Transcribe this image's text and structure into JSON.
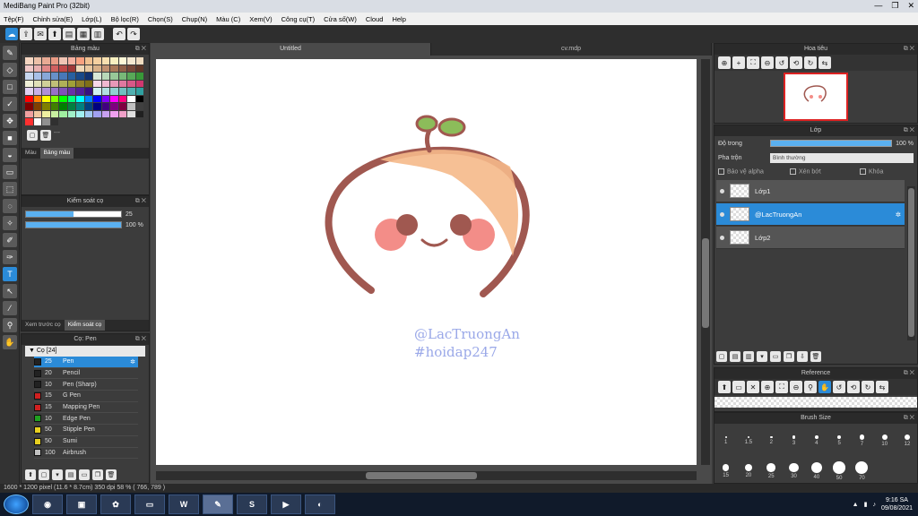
{
  "window": {
    "title": "MediBang Paint Pro (32bit)",
    "controls": [
      "—",
      "❐",
      "✕"
    ]
  },
  "menu": [
    "Tệp(F)",
    "Chỉnh sửa(E)",
    "Lớp(L)",
    "Bộ lọc(R)",
    "Chọn(S)",
    "Chụp(N)",
    "Màu (C)",
    "Xem(V)",
    "Công cụ(T)",
    "Cửa số(W)",
    "Cloud",
    "Help"
  ],
  "palette": {
    "title": "Bảng màu",
    "tabs": [
      "Màu",
      "Bảng màu"
    ],
    "colors": [
      "#f5d6c2",
      "#ecc0a8",
      "#e8aa94",
      "#e89a84",
      "#f0c4b4",
      "#f5b0a0",
      "#f7a080",
      "#f0c090",
      "#f5d0a0",
      "#f8e0b0",
      "#f8f0c0",
      "#fff8d8",
      "#f5e8d0",
      "#f0dcc0",
      "#f0c8c8",
      "#e8b0b0",
      "#e08888",
      "#d06060",
      "#c04848",
      "#a03838",
      "#f0d8b8",
      "#e8c8a0",
      "#d8b088",
      "#c09070",
      "#a87858",
      "#906048",
      "#784838",
      "#603828",
      "#c8d8f0",
      "#a8c0e8",
      "#88a8d8",
      "#6890c8",
      "#4878b8",
      "#2860a0",
      "#184888",
      "#103070",
      "#d8e8d8",
      "#b8d8b8",
      "#98c898",
      "#78b878",
      "#58a858",
      "#389838",
      "#f0f0d8",
      "#e0e0b8",
      "#d0d098",
      "#c0c078",
      "#b0b058",
      "#a0a038",
      "#908028",
      "#807018",
      "#f8d8e8",
      "#f0b8d0",
      "#e898b8",
      "#e078a0",
      "#d85888",
      "#d03870",
      "#e0d0f0",
      "#c8b0e8",
      "#b090d8",
      "#9870c8",
      "#8050b8",
      "#6830a8",
      "#502098",
      "#381080",
      "#d0f0f0",
      "#b0e0e0",
      "#90d0d0",
      "#70c0c0",
      "#50b0b0",
      "#30a0a0",
      "#ff0000",
      "#ff8000",
      "#ffff00",
      "#80ff00",
      "#00ff00",
      "#00ff80",
      "#00ffff",
      "#0080ff",
      "#0000ff",
      "#8000ff",
      "#ff00ff",
      "#ff0080",
      "#ffffff",
      "#000000",
      "#800000",
      "#804000",
      "#808000",
      "#408000",
      "#008000",
      "#008040",
      "#008080",
      "#004080",
      "#000080",
      "#400080",
      "#800080",
      "#800040",
      "#c0c0c0",
      "#404040",
      "#f0a0a0",
      "#f0c8a0",
      "#f0f0a0",
      "#c8f0a0",
      "#a0f0a0",
      "#a0f0c8",
      "#a0f0f0",
      "#a0c8f0",
      "#a0a0f0",
      "#c8a0f0",
      "#f0a0f0",
      "#f0a0c8",
      "#e0e0e0",
      "#202020",
      "#ff3030",
      "#ffffff",
      "#909090",
      "#303030"
    ]
  },
  "brush_control": {
    "title": "Kiểm soát cọ",
    "size_value": "25",
    "size_frac": 0.5,
    "opacity_value": "100 %",
    "opacity_frac": 1.0
  },
  "brush_list": {
    "tabs": [
      "Xem trước cọ",
      "Kiểm soát cọ"
    ],
    "title": "Cọ: Pen",
    "group": "Cọ [24]",
    "items": [
      {
        "size": "25",
        "name": "Pen",
        "color": "#222222"
      },
      {
        "size": "20",
        "name": "Pencil",
        "color": "#222222"
      },
      {
        "size": "10",
        "name": "Pen (Sharp)",
        "color": "#222222"
      },
      {
        "size": "15",
        "name": "G Pen",
        "color": "#d02020"
      },
      {
        "size": "15",
        "name": "Mapping Pen",
        "color": "#d02020"
      },
      {
        "size": "10",
        "name": "Edge Pen",
        "color": "#20a020"
      },
      {
        "size": "50",
        "name": "Stipple Pen",
        "color": "#e8d020"
      },
      {
        "size": "50",
        "name": "Sumi",
        "color": "#e8d020"
      },
      {
        "size": "100",
        "name": "Airbrush",
        "color": "#c0c0c0"
      }
    ]
  },
  "documents": {
    "tabs": [
      "Untitled",
      "cv.mdp"
    ]
  },
  "canvas": {
    "watermark1": "@LacTruongAn",
    "watermark2": "#hoidap247"
  },
  "navigator": {
    "title": "Hoa tiêu"
  },
  "layers": {
    "title": "Lớp",
    "opacity_label": "Độ trong",
    "opacity_value": "100 %",
    "blend_label": "Pha trộn",
    "blend_value": "Bình thường",
    "protect_alpha": "Bảo vệ alpha",
    "clipping": "Xén bớt",
    "lock": "Khóa",
    "items": [
      {
        "name": "Lớp1",
        "selected": false
      },
      {
        "name": "@LacTruongAn",
        "selected": true
      },
      {
        "name": "Lớp2",
        "selected": false
      }
    ]
  },
  "reference": {
    "title": "Reference"
  },
  "brush_size": {
    "title": "Brush Size",
    "sizes": [
      "1",
      "1.5",
      "2",
      "3",
      "4",
      "5",
      "7",
      "10",
      "12",
      "15",
      "20",
      "25",
      "30",
      "40",
      "50",
      "70"
    ]
  },
  "status": {
    "text": "1600 * 1200 pixel   (11.6 * 8.7cm)   350 dpi   58 %   ( 766, 789 )"
  },
  "taskbar": {
    "time": "9:16 SA",
    "date": "09/08/2021"
  }
}
